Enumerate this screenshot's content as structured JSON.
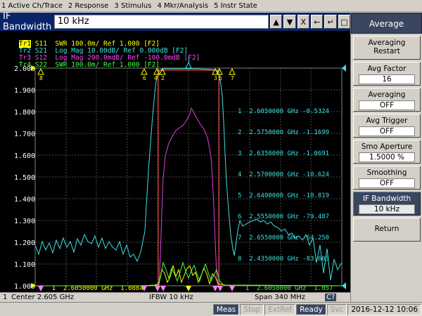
{
  "menu": [
    "1 Active Ch/Trace",
    "2 Response",
    "3 Stimulus",
    "4 Mkr/Analysis",
    "5 Instr State"
  ],
  "entry": {
    "label": "IF Bandwidth",
    "value": "10 kHz",
    "btn_up": "▲",
    "btn_down": "▼",
    "btn_close": "X",
    "btn_back": "←",
    "btn_enter": "↵",
    "btn_clear": "□"
  },
  "traces": [
    {
      "id": "Tr1",
      "text": "S11  SWR 100.0m/ Ref 1.000 [F2]",
      "color": "#ffff00"
    },
    {
      "id": "Tr2",
      "text": "S21  Log Mag 10.00dB/ Ref 0.000dB [F2]",
      "color": "#40e0e0"
    },
    {
      "id": "Tr3",
      "text": "S12  Log Mag 200.0mdB/ Ref -100.0mdB [F2]",
      "color": "#ff40ff"
    },
    {
      "id": "Tr4",
      "text": "S22  SWR 100.0m/ Ref 1.000 [F2]",
      "color": "#40ff40"
    }
  ],
  "yaxis": {
    "labels": [
      "2.000",
      "1.900",
      "1.800",
      "1.700",
      "1.600",
      "1.500",
      "1.400",
      "1.300",
      "1.200",
      "1.100",
      "1.000"
    ]
  },
  "markers": [
    {
      "n": "1",
      "freq": "2.6050000 GHz",
      "val": "-0.5324"
    },
    {
      "n": "2",
      "freq": "2.5750000 GHz",
      "val": "-1.1699"
    },
    {
      "n": "3",
      "freq": "2.6350000 GHz",
      "val": "-1.0691"
    },
    {
      "n": "4",
      "freq": "2.5700000 GHz",
      "val": "-10.624"
    },
    {
      "n": "5",
      "freq": "2.6400000 GHz",
      "val": "-10.819"
    },
    {
      "n": "6",
      "freq": "2.5550000 GHz",
      "val": "-79.487"
    },
    {
      "n": "7",
      "freq": "2.6550000 GHz",
      "val": "-64.250"
    },
    {
      "n": "8",
      "freq": "2.4350000 GHz",
      "val": "-83.603"
    }
  ],
  "marker_readout_left": {
    "n": "1",
    "freq": "2.6050000 GHz",
    "val": "1.0884"
  },
  "marker_readout_right": {
    "n": "1",
    "freq": "2.6050000 GHz",
    "val": "1.057"
  },
  "status1": {
    "channel": "1",
    "center": "Center 2.605 GHz",
    "ifbw": "IFBW 10 kHz",
    "span": "Span 340 MHz",
    "c_badge": "C?"
  },
  "status2": {
    "meas": "Meas",
    "stop": "Stop",
    "extref": "ExtRef",
    "ready": "Ready",
    "svc": "Svc",
    "datetime": "2016-12-12 10:06"
  },
  "softkeys": {
    "header": "Average",
    "items": [
      {
        "title": "Averaging",
        "title2": "Restart",
        "value": ""
      },
      {
        "title": "Avg Factor",
        "value": "16"
      },
      {
        "title": "Averaging",
        "value": "OFF"
      },
      {
        "title": "Avg Trigger",
        "value": "OFF"
      },
      {
        "title": "Smo Aperture",
        "value": "1.5000 %"
      },
      {
        "title": "Smoothing",
        "value": "OFF"
      },
      {
        "title": "IF Bandwidth",
        "value": "10 kHz"
      },
      {
        "title": "Return",
        "value": ""
      }
    ]
  },
  "colors": {
    "s11": "#ffff00",
    "s21": "#40e0e0",
    "s12": "#ff40ff",
    "s22": "#40ff40",
    "limit": "#ff6060",
    "grid": "#505050"
  }
}
